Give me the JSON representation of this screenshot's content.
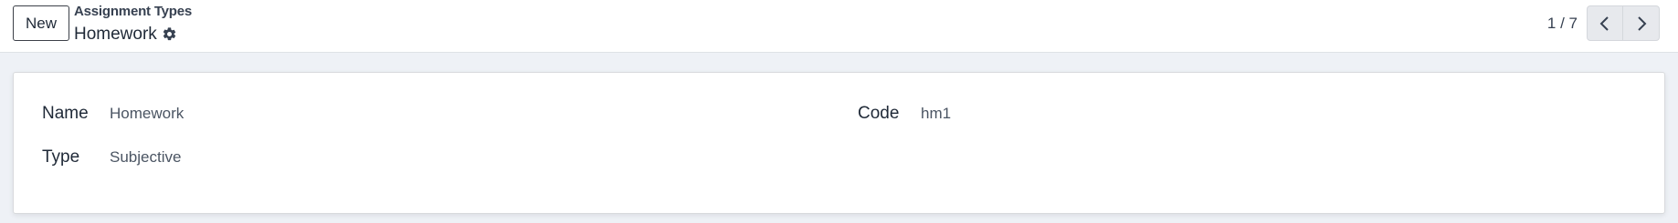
{
  "control_panel": {
    "new_button_label": "New",
    "breadcrumb_parent": "Assignment Types",
    "record_title": "Homework",
    "pager_value": "1 / 7"
  },
  "form": {
    "name_label": "Name",
    "name_value": "Homework",
    "code_label": "Code",
    "code_value": "hm1",
    "type_label": "Type",
    "type_value": "Subjective"
  },
  "icons": {
    "settings": "gear-icon",
    "previous": "chevron-left-icon",
    "next": "chevron-right-icon"
  },
  "colors": {
    "background": "#eef1f6",
    "sheet": "#ffffff",
    "pager_button": "#e7e9ed"
  }
}
